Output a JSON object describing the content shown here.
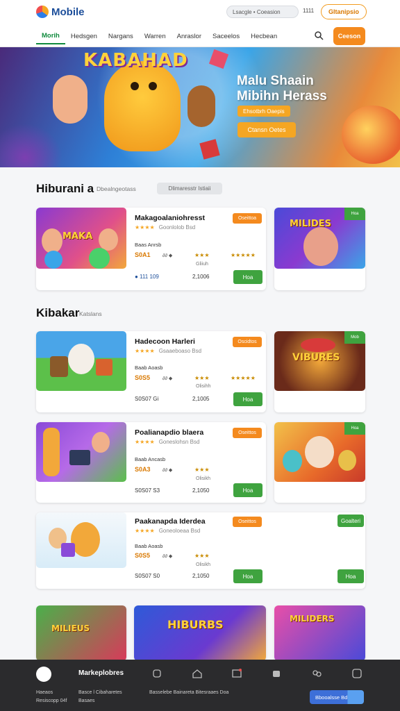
{
  "header": {
    "logo_text": "Mobile",
    "search_text": "Lsacgle • Coeasion",
    "count": "1111",
    "top_button": "Gltanipsio",
    "nav": [
      "Morih",
      "Hedsgen",
      "Nargans",
      "Warren",
      "Anraslor",
      "Saceelos",
      "Hecbean"
    ],
    "cta": "Ceeson"
  },
  "hero": {
    "sign_text": "KABAHAD",
    "title_line1": "Malu Shaain",
    "title_line2": "Mibihn Herass",
    "tag": "Ehsotbrh Oaepis",
    "button": "Ctansn Oetes"
  },
  "section1": {
    "title": "Hiburani a",
    "subtitle": "Dbealngeotass",
    "pill": "Dlimaresstr Istiaii"
  },
  "section2": {
    "title": "Kibakar",
    "subtitle": "Katslans"
  },
  "cards": [
    {
      "title": "Makagoalaniohresst",
      "stars": "★★★★",
      "stars_sub": "Goonlolob Bsd",
      "meta": "Baas Anrsb",
      "price": "S0A1",
      "price_mid": "∂∂ ◆",
      "rating": "★★★",
      "rating_b": "★★★★★",
      "small": "Gliiuh",
      "foot_left": "● 111 109",
      "foot_mid": "2,1006",
      "tag": "Oseittoa",
      "button": "Hoa",
      "thumb_label": "MAKA"
    },
    {
      "title": "Hadecoon Harleri",
      "stars": "★★★★",
      "stars_sub": "Gsaaeboaso Bsd",
      "meta": "Baab Aoasb",
      "price": "S0S5",
      "price_mid": "∂∂ ◆",
      "rating": "★★★",
      "rating_b": "★★★★★",
      "small": "Olisihh",
      "foot_left": "S0S07 Gi",
      "foot_mid": "2,1005",
      "tag": "Oscidtos",
      "button": "Hoa",
      "thumb_label": ""
    },
    {
      "title": "Poalianapdio blaera",
      "stars": "★★★★",
      "stars_sub": "Goneslohsn Bsd",
      "meta": "Baab Ancasb",
      "price": "S0A3",
      "price_mid": "∂∂ ◆",
      "rating": "★★★",
      "rating_b": "",
      "small": "Olisikh",
      "foot_left": "S0S07 S3",
      "foot_mid": "2,1050",
      "tag": "Oseittos",
      "button": "Hoa",
      "thumb_label": ""
    },
    {
      "title": "Paakanapda Iderdea",
      "stars": "★★★★",
      "stars_sub": "Goneoloeaa Bsd",
      "meta": "Baab Aoasb",
      "price": "S0S5",
      "price_mid": "∂∂ ◆",
      "rating": "★★★",
      "rating_b": "",
      "small": "Olisikh",
      "foot_left": "S0S07 S0",
      "foot_mid": "2,1050",
      "tag": "Oseittos",
      "button": "Hoa",
      "thumb_label": ""
    }
  ],
  "side_tiles": [
    {
      "label": "MILIDES",
      "ribbon": "Hoa"
    },
    {
      "label": "VIBURES",
      "ribbon": "Mob"
    },
    {
      "label": "",
      "ribbon": "Hoa"
    },
    {
      "label": "",
      "ribbon": "Goalteri",
      "button": "Hoa"
    }
  ],
  "bottom_row": [
    {
      "label": "MILIEUS"
    },
    {
      "label": "HIBURBS"
    },
    {
      "label": "MILIDERS"
    }
  ],
  "bottombar": {
    "title": "Markeplobres",
    "col1": [
      "Haeaos",
      "Resiscopp  04f"
    ],
    "col2": [
      "Basce  l Cibaharetes",
      "Basaes"
    ],
    "col3": "Basselebe  Bainareta      Bitesraaes  Doa",
    "button": "Bbooalsse   Bd"
  },
  "colors": {
    "accent_orange": "#f48a1e",
    "accent_green": "#3fa33f",
    "nav_active": "#0f8a3c",
    "bottombar": "#2b2b2d"
  }
}
